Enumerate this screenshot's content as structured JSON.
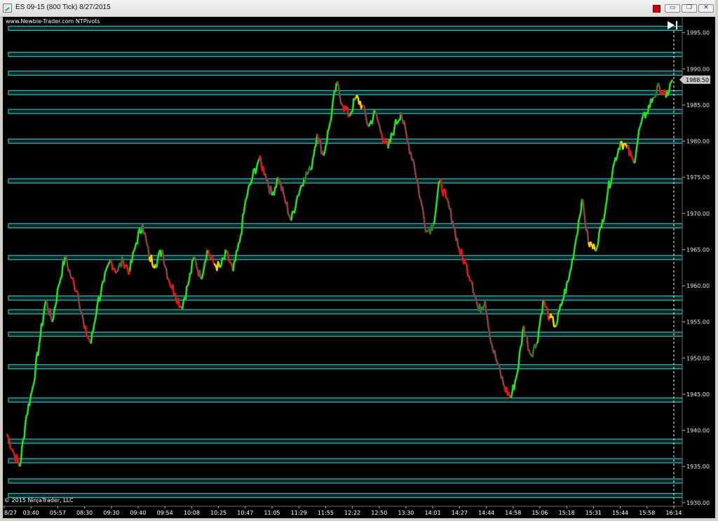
{
  "window": {
    "title": "ES 09-15 (800 Tick)  8/27/2015",
    "minimize_glyph": "▭",
    "restore_glyph": "❐",
    "close_glyph": "✕"
  },
  "chart_data": {
    "type": "line",
    "watermark_top": "www.Newbie-Trader.com  NTPivots",
    "copyright": "© 2015 NinjaTrader, LLC",
    "price_badge": "1988.50",
    "current_price": 1988.5,
    "ylim": [
      1929.5,
      1997
    ],
    "y_ticks": [
      1930,
      1935,
      1940,
      1945,
      1950,
      1955,
      1960,
      1965,
      1970,
      1975,
      1980,
      1985,
      1990,
      1995
    ],
    "y_tick_labels": [
      "1930.00",
      "1935.00",
      "1940.00",
      "1945.00",
      "1950.00",
      "1955.00",
      "1960.00",
      "1965.00",
      "1970.00",
      "1975.00",
      "1980.00",
      "1985.00",
      "1990.00",
      "1995.00"
    ],
    "x_tick_labels": [
      "8/27",
      "03:40",
      "05:57",
      "08:30",
      "09:30",
      "09:40",
      "09:54",
      "10:08",
      "10:25",
      "10:47",
      "11:05",
      "11:29",
      "11:55",
      "12:22",
      "12:50",
      "13:30",
      "14:01",
      "14:27",
      "14:44",
      "14:58",
      "15:06",
      "15:18",
      "15:31",
      "15:44",
      "15:58",
      "16:14"
    ],
    "pivot_levels": [
      1931.0,
      1933.0,
      1935.8,
      1938.5,
      1944.2,
      1948.8,
      1953.3,
      1956.4,
      1958.3,
      1963.9,
      1968.3,
      1974.5,
      1980.0,
      1984.1,
      1986.7,
      1989.4,
      1992.0,
      1995.6
    ],
    "series": [
      {
        "values": [
          1939.5,
          1937.0,
          1935.0,
          1942.0,
          1946.0,
          1952.0,
          1958.0,
          1955.0,
          1960.0,
          1964.0,
          1961.0,
          1959.0,
          1954.0,
          1952.0,
          1957.5,
          1960.5,
          1963.5,
          1962.0,
          1963.5,
          1962.0,
          1966.0,
          1968.5,
          1964.0,
          1963.0,
          1965.0,
          1961.0,
          1959.0,
          1957.0,
          1960.0,
          1964.0,
          1961.0,
          1965.0,
          1963.0,
          1962.5,
          1964.5,
          1962.0,
          1966.0,
          1972.0,
          1975.0,
          1977.5,
          1975.5,
          1972.5,
          1975.0,
          1972.0,
          1969.0,
          1972.5,
          1975.0,
          1976.0,
          1981.0,
          1978.0,
          1982.5,
          1988.0,
          1985.0,
          1983.5,
          1986.0,
          1985.0,
          1982.0,
          1984.0,
          1981.0,
          1979.0,
          1982.0,
          1984.0,
          1980.0,
          1977.0,
          1972.0,
          1967.5,
          1968.5,
          1974.5,
          1972.0,
          1969.0,
          1965.0,
          1963.0,
          1960.5,
          1956.5,
          1958.0,
          1952.0,
          1949.0,
          1946.0,
          1944.5,
          1948.0,
          1954.5,
          1950.5,
          1952.0,
          1958.0,
          1955.5,
          1954.5,
          1958.0,
          1961.0,
          1966.0,
          1972.0,
          1966.0,
          1965.0,
          1968.0,
          1973.0,
          1977.0,
          1980.0,
          1979.0,
          1977.0,
          1982.0,
          1984.0,
          1986.0,
          1987.5,
          1986.0,
          1988.5
        ]
      }
    ]
  },
  "colors": {
    "background": "#000000",
    "pivot_fill": "#0a2a2a",
    "pivot_border": "#3ab4b4",
    "up_strong": "#22dd22",
    "up_weak": "#2f7a2f",
    "neutral": "#ffcc00",
    "down": "#e01818",
    "down_weak": "#8a4040",
    "badge": "#c8c8c8",
    "end_marker": "#ffffff"
  }
}
